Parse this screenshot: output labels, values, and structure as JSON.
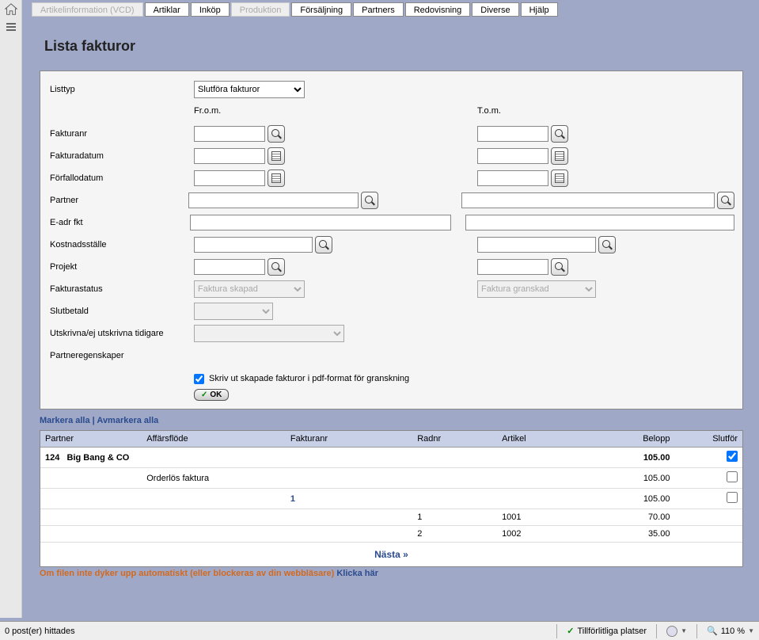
{
  "tabs": {
    "artikelinfo": "Artikelinformation (VCD)",
    "artiklar": "Artiklar",
    "inkop": "Inköp",
    "produktion": "Produktion",
    "forsaljning": "Försäljning",
    "partners": "Partners",
    "redovisning": "Redovisning",
    "diverse": "Diverse",
    "hjalp": "Hjälp"
  },
  "page": {
    "title": "Lista fakturor"
  },
  "form": {
    "listtyp_label": "Listtyp",
    "listtyp_value": "Slutföra fakturor",
    "from_label": "Fr.o.m.",
    "to_label": "T.o.m.",
    "fakturanr": "Fakturanr",
    "fakturadatum": "Fakturadatum",
    "forfallodatum": "Förfallodatum",
    "partner": "Partner",
    "eadr": "E-adr fkt",
    "kostnadsstalle": "Kostnadsställe",
    "projekt": "Projekt",
    "fakturastatus": "Fakturastatus",
    "fakturastatus_from": "Faktura skapad",
    "fakturastatus_to": "Faktura granskad",
    "slutbetald": "Slutbetald",
    "utskrivna": "Utskrivna/ej utskrivna tidigare",
    "partneregenskaper": "Partneregenskaper",
    "pdf_checkbox": "Skriv ut skapade fakturor i pdf-format för granskning",
    "ok": "OK"
  },
  "links": {
    "markera": "Markera alla",
    "avmarkera": "Avmarkera alla"
  },
  "table": {
    "headers": {
      "partner": "Partner",
      "affarsflode": "Affärsflöde",
      "fakturanr": "Fakturanr",
      "radnr": "Radnr",
      "artikel": "Artikel",
      "belopp": "Belopp",
      "slutfor": "Slutför"
    },
    "row_partner_id": "124",
    "row_partner_name": "Big Bang & CO",
    "row_partner_total": "105.00",
    "row_flow": "Orderlös faktura",
    "row_flow_amount": "105.00",
    "row_invoice_nr": "1",
    "row_invoice_amount": "105.00",
    "line1_radnr": "1",
    "line1_artikel": "1001",
    "line1_belopp": "70.00",
    "line2_radnr": "2",
    "line2_artikel": "1002",
    "line2_belopp": "35.00"
  },
  "nasta": "Nästa »",
  "warning": {
    "text": "Om filen inte dyker upp automatiskt (eller blockeras av din webbläsare) ",
    "link": "Klicka här"
  },
  "statusbar": {
    "poster": "0 post(er) hittades",
    "tillforlitliga": "Tillförlitliga platser",
    "zoom": "110 %"
  }
}
